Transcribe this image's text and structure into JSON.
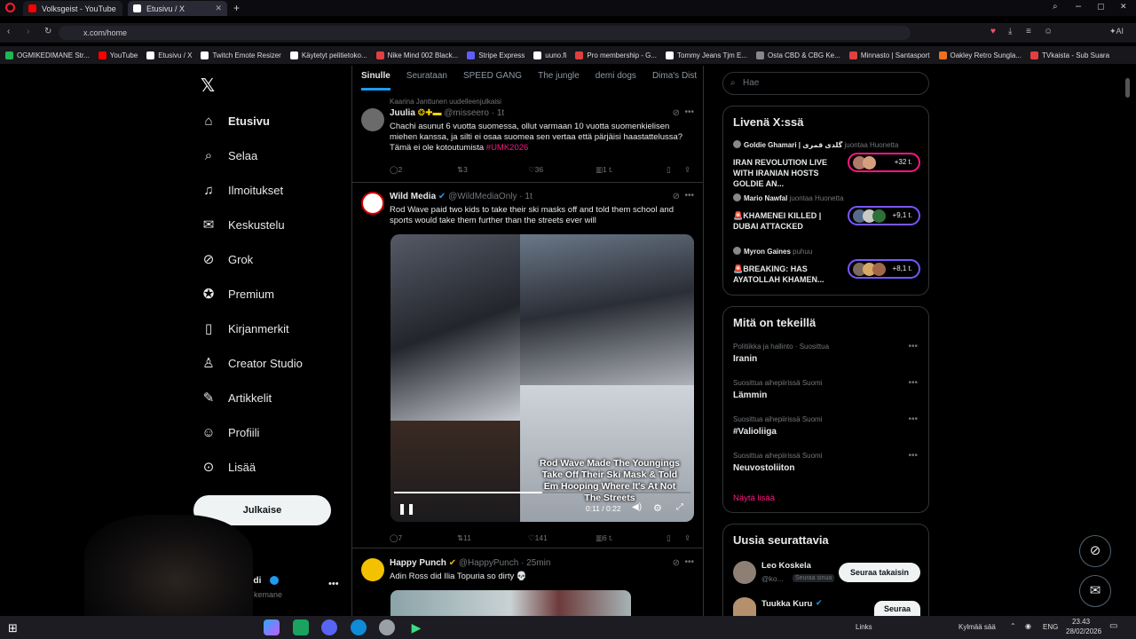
{
  "browser": {
    "tabs": [
      {
        "title": "Volksgeist - YouTube",
        "color": "#ff0000"
      },
      {
        "title": "Etusivu / X",
        "color": "#ffffff"
      }
    ],
    "url": "x.com/home",
    "bookmarks": [
      {
        "label": "OGMIKEDIMANE Str...",
        "color": "#1db954"
      },
      {
        "label": "YouTube",
        "color": "#ff0000"
      },
      {
        "label": "Etusivu / X",
        "color": "#ffffff"
      },
      {
        "label": "Twitch Emote Resizer",
        "color": "#ffffff"
      },
      {
        "label": "Käytetyt pelitietoko...",
        "color": "#ffffff"
      },
      {
        "label": "Nike Mind 002 Black...",
        "color": "#e04040"
      },
      {
        "label": "Stripe Express",
        "color": "#635bff"
      },
      {
        "label": "uuno.fi",
        "color": "#ffffff"
      },
      {
        "label": "Pro membership - G...",
        "color": "#e04040"
      },
      {
        "label": "Tommy Jeans Tjm E...",
        "color": "#ffffff"
      },
      {
        "label": "Osta CBD & CBG Ke...",
        "color": "#888888"
      },
      {
        "label": "Minnasto | Santasport",
        "color": "#e04040"
      },
      {
        "label": "Oakley Retro Sungla...",
        "color": "#f07020"
      },
      {
        "label": "TVkaista - Sub Suara",
        "color": "#e04040"
      }
    ]
  },
  "nav": {
    "items": [
      {
        "label": "Etusivu",
        "icon": "home-icon",
        "glyph": "⌂"
      },
      {
        "label": "Selaa",
        "icon": "search-icon",
        "glyph": "⌕"
      },
      {
        "label": "Ilmoitukset",
        "icon": "bell-icon",
        "glyph": "♫"
      },
      {
        "label": "Keskustelu",
        "icon": "mail-icon",
        "glyph": "✉"
      },
      {
        "label": "Grok",
        "icon": "grok-icon",
        "glyph": "⊘"
      },
      {
        "label": "Premium",
        "icon": "verified-icon",
        "glyph": "✪"
      },
      {
        "label": "Kirjanmerkit",
        "icon": "bookmark-icon",
        "glyph": "▯"
      },
      {
        "label": "Creator Studio",
        "icon": "creator-icon",
        "glyph": "♙"
      },
      {
        "label": "Artikkelit",
        "icon": "article-icon",
        "glyph": "✎"
      },
      {
        "label": "Profiili",
        "icon": "profile-icon",
        "glyph": "☺"
      },
      {
        "label": "Lisää",
        "icon": "more-circle-icon",
        "glyph": "⊙"
      }
    ],
    "post_label": "Julkaise",
    "account_name": "edi",
    "account_handle": "kemane"
  },
  "feed": {
    "tabs": [
      "Sinulle",
      "Seurataan",
      "SPEED GANG",
      "The jungle",
      "demi dogs",
      "Dima's Dist"
    ],
    "context_line": "Kaarina Janttunen uudelleenjulkaisi",
    "tweets": [
      {
        "name": "Juulia",
        "handle": "@misseero",
        "time": "· 1t",
        "text": "Chachi asunut 6 vuotta suomessa, ollut varmaan 10 vuotta suomenkielisen miehen kanssa, ja silti ei osaa suomea sen vertaa että pärjäisi haastattelussa? Tämä ei ole kotoutumista",
        "hashtag": "#UMK2026",
        "replies": "2",
        "reposts": "3",
        "likes": "36",
        "views": "1 t."
      },
      {
        "name": "Wild Media",
        "handle": "@WildMediaOnly",
        "time": "· 1t",
        "text": "Rod Wave paid two kids to take their ski masks off and told them school and sports would take them further than the streets ever will",
        "video_caption": "Rod Wave Made The Youngings Take Off Their Ski Mask & Told Em Hooping Where It's At Not The Streets",
        "video_time": "0:11 / 0:22",
        "replies": "7",
        "reposts": "11",
        "likes": "141",
        "views": "6 t."
      },
      {
        "name": "Happy Punch",
        "handle": "@HappyPunch",
        "time": "· 25min",
        "text": "Adin Ross did Ilia Topuria so dirty 💀"
      }
    ]
  },
  "right": {
    "search_placeholder": "Hae",
    "live_title": "Livenä X:ssä",
    "live": [
      {
        "host": "Goldie Ghamari | گلدی قمری",
        "role": "juontaa Huonetta",
        "title": "IRAN REVOLUTION LIVE WITH IRANIAN HOSTS GOLDIE AN...",
        "count": "+32 t."
      },
      {
        "host": "Mario Nawfal",
        "role": "juontaa Huonetta",
        "title": "🚨KHAMENEI KILLED | DUBAI ATTACKED",
        "count": "+9,1 t."
      },
      {
        "host": "Myron Gaines",
        "role": "puhuu",
        "title": "🚨BREAKING: HAS AYATOLLAH KHAMEN...",
        "count": "+8,1 t."
      }
    ],
    "trends_title": "Mitä on tekeillä",
    "trends": [
      {
        "meta": "Politiikka ja hallinto · Suosittua",
        "name": "Iranin"
      },
      {
        "meta": "Suosittua aihepiirissä Suomi",
        "name": "Lämmin"
      },
      {
        "meta": "Suosittua aihepiirissä Suomi",
        "name": "#Valioliiga"
      },
      {
        "meta": "Suosittua aihepiirissä Suomi",
        "name": "Neuvostoliiton"
      }
    ],
    "show_more": "Näytä lisää",
    "follow_title": "Uusia seurattavia",
    "follow": [
      {
        "name": "Leo Koskela",
        "handle": "@ko...",
        "badge": "Seuraa sinua",
        "button": "Seuraa takaisin"
      },
      {
        "name": "Tuukka Kuru",
        "button": "Seuraa"
      }
    ]
  },
  "taskbar": {
    "links": "Links",
    "weather": "Kylmää sää",
    "lang": "ENG",
    "time": "23.43",
    "date": "28/02/2026"
  },
  "colors": {
    "accent": "#1d9bf0",
    "hashtag": "#f91880",
    "live_border": "#7856ff"
  }
}
